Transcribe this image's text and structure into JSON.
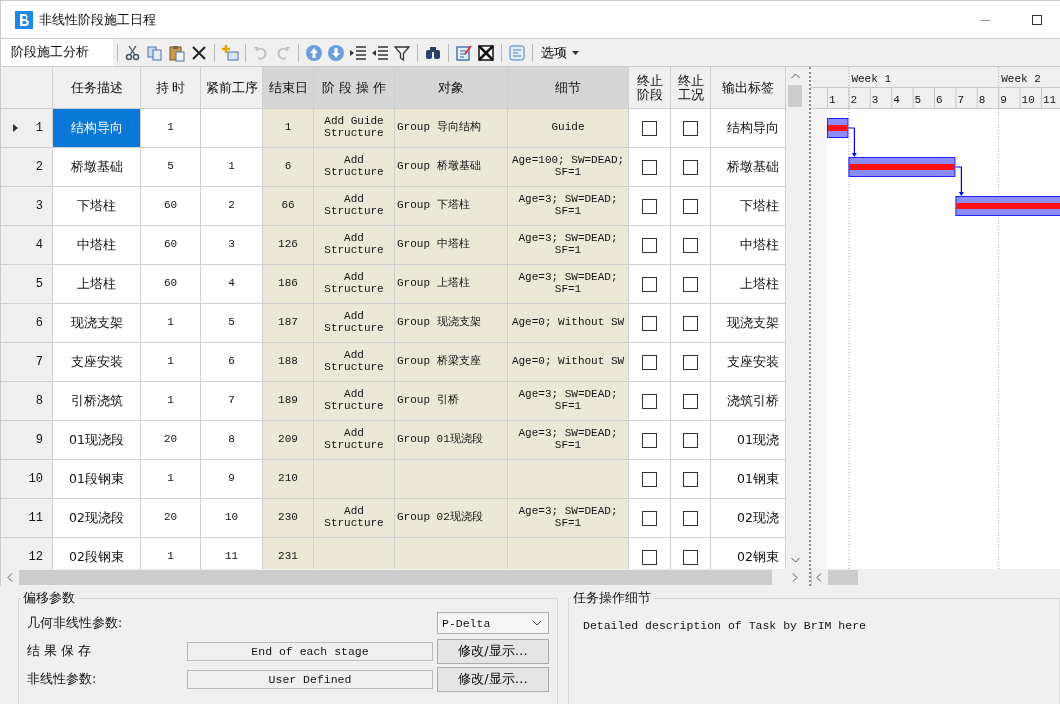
{
  "window": {
    "title": "非线性阶段施工日程"
  },
  "toolbar": {
    "label": "阶段施工分析",
    "groups": [
      [
        {
          "kind": "cut",
          "disabled": false
        },
        {
          "kind": "copy",
          "disabled": false
        },
        {
          "kind": "paste",
          "disabled": false
        },
        {
          "kind": "delete",
          "disabled": false
        }
      ],
      [
        {
          "kind": "insert",
          "disabled": false
        }
      ],
      [
        {
          "kind": "undo",
          "disabled": true
        },
        {
          "kind": "redo",
          "disabled": true
        }
      ],
      [
        {
          "kind": "up",
          "disabled": false
        },
        {
          "kind": "down",
          "disabled": false
        },
        {
          "kind": "indent",
          "disabled": false
        },
        {
          "kind": "outdent",
          "disabled": false
        },
        {
          "kind": "filter",
          "disabled": false
        }
      ],
      [
        {
          "kind": "find",
          "disabled": false
        }
      ],
      [
        {
          "kind": "edit",
          "disabled": false
        },
        {
          "kind": "clear",
          "disabled": false
        }
      ],
      [
        {
          "kind": "layout",
          "disabled": false
        }
      ]
    ],
    "menu": "选项"
  },
  "table": {
    "columns": [
      {
        "label": "任务描述",
        "readonly": false
      },
      {
        "label": "持 时",
        "readonly": false
      },
      {
        "label": "紧前工序",
        "readonly": false
      },
      {
        "label": "结束日",
        "readonly": true
      },
      {
        "label": "阶 段 操 作",
        "readonly": true
      },
      {
        "label": "对象",
        "readonly": true
      },
      {
        "label": "细节",
        "readonly": true
      },
      {
        "label": "终止阶段",
        "readonly": false
      },
      {
        "label": "终止工况",
        "readonly": false
      },
      {
        "label": "输出标签",
        "readonly": false
      }
    ],
    "rows": [
      {
        "number": "1",
        "selected": true,
        "task": "结构导向",
        "duration": "1",
        "end": "1",
        "operation": "Add Guide Structure",
        "object": "Group 导向结构",
        "detail": "Guide",
        "stop_stage": false,
        "stop_case": false,
        "output": "结构导向"
      },
      {
        "number": "2",
        "selected": false,
        "task": "桥墩基础",
        "duration": "5",
        "predecessor": "1",
        "end": "6",
        "operation": "Add Structure",
        "object": "Group 桥墩基础",
        "detail": "Age=100; SW=DEAD; SF=1",
        "stop_stage": false,
        "stop_case": false,
        "output": "桥墩基础"
      },
      {
        "number": "3",
        "selected": false,
        "task": "下塔柱",
        "duration": "60",
        "predecessor": "2",
        "end": "66",
        "operation": "Add Structure",
        "object": "Group 下塔柱",
        "detail": "Age=3; SW=DEAD; SF=1",
        "stop_stage": false,
        "stop_case": false,
        "output": "下塔柱"
      },
      {
        "number": "4",
        "selected": false,
        "task": "中塔柱",
        "duration": "60",
        "predecessor": "3",
        "end": "126",
        "operation": "Add Structure",
        "object": "Group 中塔柱",
        "detail": "Age=3; SW=DEAD; SF=1",
        "stop_stage": false,
        "stop_case": false,
        "output": "中塔柱"
      },
      {
        "number": "5",
        "selected": false,
        "task": "上塔柱",
        "duration": "60",
        "predecessor": "4",
        "end": "186",
        "operation": "Add Structure",
        "object": "Group 上塔柱",
        "detail": "Age=3; SW=DEAD; SF=1",
        "stop_stage": false,
        "stop_case": false,
        "output": "上塔柱"
      },
      {
        "number": "6",
        "selected": false,
        "task": "现浇支架",
        "duration": "1",
        "predecessor": "5",
        "end": "187",
        "operation": "Add Structure",
        "object": "Group 现浇支架",
        "detail": "Age=0; Without SW",
        "stop_stage": false,
        "stop_case": false,
        "output": "现浇支架"
      },
      {
        "number": "7",
        "selected": false,
        "task": "支座安装",
        "duration": "1",
        "predecessor": "6",
        "end": "188",
        "operation": "Add Structure",
        "object": "Group 桥梁支座",
        "detail": "Age=0; Without SW",
        "stop_stage": false,
        "stop_case": false,
        "output": "支座安装"
      },
      {
        "number": "8",
        "selected": false,
        "task": "引桥浇筑",
        "duration": "1",
        "predecessor": "7",
        "end": "189",
        "operation": "Add Structure",
        "object": "Group 引桥",
        "detail": "Age=3; SW=DEAD; SF=1",
        "stop_stage": false,
        "stop_case": false,
        "output": "浇筑引桥"
      },
      {
        "number": "9",
        "selected": false,
        "task": "01现浇段",
        "duration": "20",
        "predecessor": "8",
        "end": "209",
        "operation": "Add Structure",
        "object": "Group 01现浇段",
        "detail": "Age=3; SW=DEAD; SF=1",
        "stop_stage": false,
        "stop_case": false,
        "output": "01现浇"
      },
      {
        "number": "10",
        "selected": false,
        "task": "01段钢束",
        "duration": "1",
        "predecessor": "9",
        "end": "210",
        "stop_stage": false,
        "stop_case": false,
        "output": "01钢束"
      },
      {
        "number": "11",
        "selected": false,
        "task": "02现浇段",
        "duration": "20",
        "predecessor": "10",
        "end": "230",
        "operation": "Add Structure",
        "object": "Group 02现浇段",
        "detail": "Age=3; SW=DEAD; SF=1",
        "stop_stage": false,
        "stop_case": false,
        "output": "02现浇"
      },
      {
        "number": "12",
        "selected": false,
        "task": "02段钢束",
        "duration": "1",
        "predecessor": "11",
        "end": "231",
        "stop_stage": false,
        "stop_case": false,
        "output": "02钢束"
      }
    ]
  },
  "gantt": {
    "weeks": [
      "Week 1",
      "Week 2"
    ],
    "days": [
      "1",
      "2",
      "3",
      "4",
      "5",
      "6",
      "7",
      "8",
      "9",
      "10",
      "11"
    ]
  },
  "settings": {
    "title": "偏移参数",
    "fields": [
      {
        "kind": "select",
        "label": "几何非线性参数:",
        "value": "P-Delta"
      },
      {
        "kind": "display",
        "label": "结 果 保 存",
        "value": "End of each stage",
        "button": "修改/显示…"
      },
      {
        "kind": "display",
        "label": "非线性参数:",
        "value": "User Defined",
        "button": "修改/显示…"
      }
    ]
  },
  "detail_panel": {
    "title": "任务操作细节",
    "text": "Detailed description of Task by BrIM here"
  }
}
